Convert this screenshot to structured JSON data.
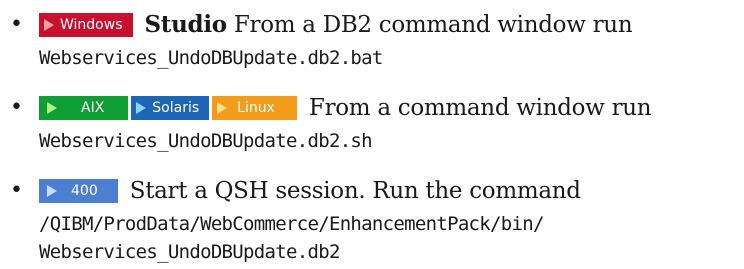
{
  "steps": [
    {
      "platforms": [
        {
          "label": "Windows",
          "color": "#c8102e"
        }
      ],
      "strong": "Studio",
      "text": "From a DB2 command window run",
      "code": [
        "Webservices_UndoDBUpdate.db2.bat"
      ]
    },
    {
      "platforms": [
        {
          "label": "AIX",
          "color": "#0f9e33"
        },
        {
          "label": "Solaris",
          "color": "#1c66b5"
        },
        {
          "label": "Linux",
          "color": "#f39c1a"
        }
      ],
      "text": "From a command window run",
      "code": [
        "Webservices_UndoDBUpdate.db2.sh"
      ]
    },
    {
      "platforms": [
        {
          "label": "400",
          "color": "#4d7fd1"
        }
      ],
      "text": "Start a QSH session. Run the command",
      "code": [
        "/QIBM/ProdData/WebCommerce/EnhancementPack/bin/",
        "Webservices_UndoDBUpdate.db2"
      ]
    }
  ],
  "bullet": "•",
  "icons": {
    "platform_marker": "right-triangle-icon"
  }
}
